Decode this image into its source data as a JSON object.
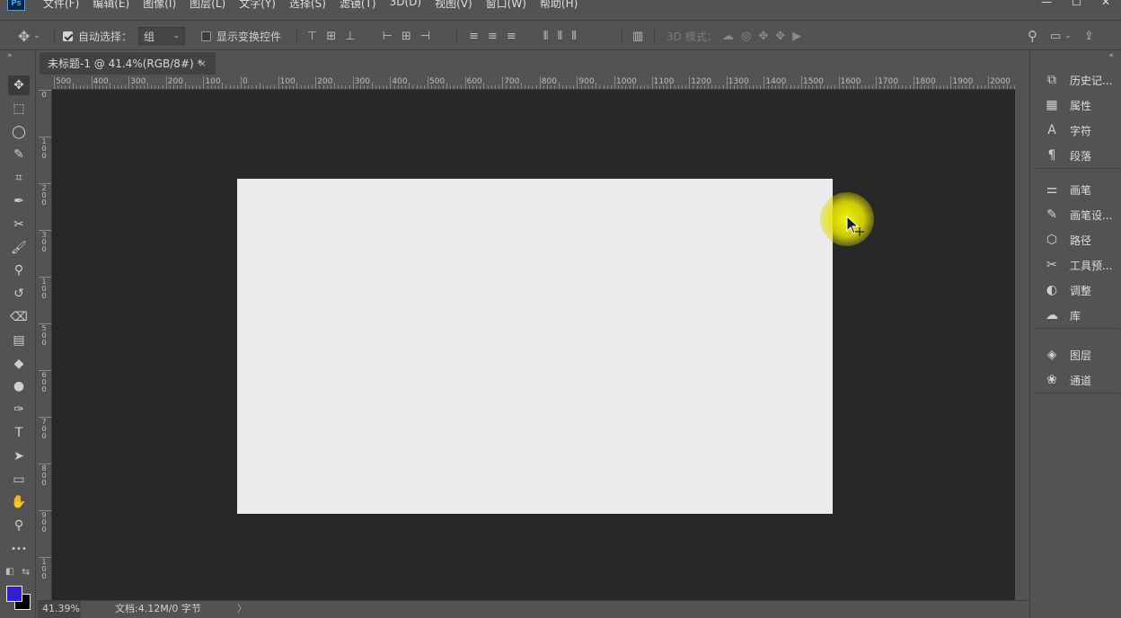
{
  "menubar": {
    "logo": "Ps",
    "items": [
      "文件(F)",
      "编辑(E)",
      "图像(I)",
      "图层(L)",
      "文字(Y)",
      "选择(S)",
      "滤镜(T)",
      "3D(D)",
      "视图(V)",
      "窗口(W)",
      "帮助(H)"
    ],
    "window_buttons": [
      "—",
      "☐",
      "✕"
    ]
  },
  "options": {
    "auto_select_label": "自动选择：",
    "auto_select_checked": true,
    "auto_select_value": "组",
    "show_transform_label": "显示变换控件",
    "show_transform_checked": false,
    "mode_3d_label": "3D 模式："
  },
  "document": {
    "tab_title": "未标题-1 @ 41.4%(RGB/8#) *",
    "close_glyph": "×",
    "artboard_color": "#ebebeb",
    "pasteboard_color": "#282828"
  },
  "ruler": {
    "h_labels": [
      "500",
      "400",
      "300",
      "200",
      "100",
      "0",
      "100",
      "200",
      "300",
      "400",
      "500",
      "600",
      "700",
      "800",
      "900",
      "1000",
      "1100",
      "1200",
      "1300",
      "1400",
      "1500",
      "1600",
      "1700",
      "1800",
      "1900",
      "2000"
    ],
    "v_labels": [
      "0",
      "1 0 0",
      "2 0 0",
      "3 0 0",
      "1 0 0",
      "5 0 0",
      "6 0 0",
      "7 0 0",
      "8 0 0",
      "9 0 0",
      "1 0 0"
    ]
  },
  "tools": [
    {
      "name": "move-tool",
      "glyph": "✥",
      "active": true
    },
    {
      "name": "marquee-tool",
      "glyph": "⬚"
    },
    {
      "name": "lasso-tool",
      "glyph": "◯"
    },
    {
      "name": "quick-select-tool",
      "glyph": "✎"
    },
    {
      "name": "crop-tool",
      "glyph": "⌗"
    },
    {
      "name": "eyedropper-tool",
      "glyph": "✒"
    },
    {
      "name": "healing-tool",
      "glyph": "✂"
    },
    {
      "name": "brush-tool",
      "glyph": "🖌"
    },
    {
      "name": "stamp-tool",
      "glyph": "⚲"
    },
    {
      "name": "history-brush-tool",
      "glyph": "↺"
    },
    {
      "name": "eraser-tool",
      "glyph": "⌫"
    },
    {
      "name": "gradient-tool",
      "glyph": "▤"
    },
    {
      "name": "blur-tool",
      "glyph": "◆"
    },
    {
      "name": "dodge-tool",
      "glyph": "●"
    },
    {
      "name": "pen-tool",
      "glyph": "✑"
    },
    {
      "name": "type-tool",
      "glyph": "T"
    },
    {
      "name": "path-select-tool",
      "glyph": "➤"
    },
    {
      "name": "rectangle-tool",
      "glyph": "▭"
    },
    {
      "name": "hand-tool",
      "glyph": "✋"
    },
    {
      "name": "zoom-tool",
      "glyph": "⚲"
    },
    {
      "name": "more-tools",
      "glyph": "•••"
    }
  ],
  "colors": {
    "foreground": "#2e1fd0",
    "background": "#000000"
  },
  "status": {
    "zoom": "41.39%",
    "doc_info": "文档:4.12M/0 字节",
    "arrow": "〉"
  },
  "panels": {
    "group1": [
      {
        "label": "历史记...",
        "icon": "history-icon",
        "glyph": "⧉"
      },
      {
        "label": "属性",
        "icon": "properties-icon",
        "glyph": "▦"
      },
      {
        "label": "字符",
        "icon": "character-icon",
        "glyph": "A"
      },
      {
        "label": "段落",
        "icon": "paragraph-icon",
        "glyph": "¶"
      }
    ],
    "group2": [
      {
        "label": "画笔",
        "icon": "brushes-icon",
        "glyph": "⚌"
      },
      {
        "label": "画笔设...",
        "icon": "brush-settings-icon",
        "glyph": "✎"
      },
      {
        "label": "路径",
        "icon": "paths-icon",
        "glyph": "⬡"
      },
      {
        "label": "工具预...",
        "icon": "tool-presets-icon",
        "glyph": "✂"
      },
      {
        "label": "调整",
        "icon": "adjustments-icon",
        "glyph": "◐"
      },
      {
        "label": "库",
        "icon": "libraries-icon",
        "glyph": "☁"
      }
    ],
    "group3": [
      {
        "label": "图层",
        "icon": "layers-icon",
        "glyph": "◈"
      },
      {
        "label": "通道",
        "icon": "channels-icon",
        "glyph": "❀"
      }
    ]
  }
}
